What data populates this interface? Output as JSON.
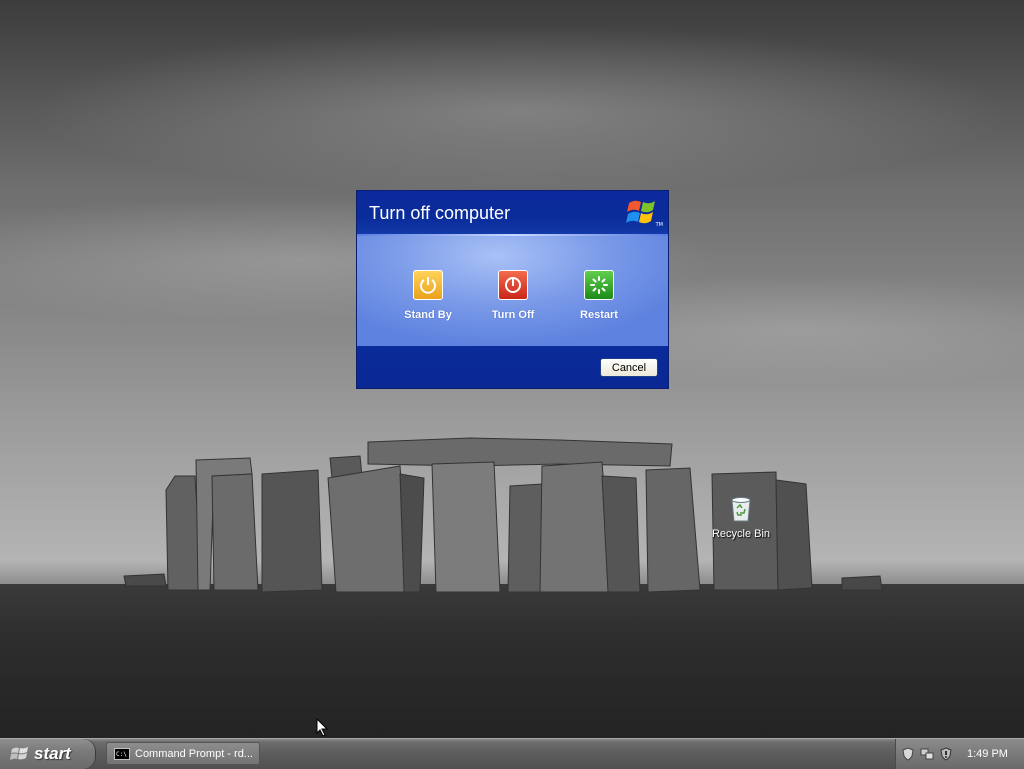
{
  "desktop": {
    "icons": [
      {
        "label": "Recycle Bin",
        "icon": "recycle-bin-icon"
      }
    ]
  },
  "dialog": {
    "title": "Turn off computer",
    "options": [
      {
        "label": "Stand By",
        "icon": "standby-icon",
        "color": "#f0b323"
      },
      {
        "label": "Turn Off",
        "icon": "power-icon",
        "color": "#e0442e"
      },
      {
        "label": "Restart",
        "icon": "restart-icon",
        "color": "#3aae2e"
      }
    ],
    "cancel_label": "Cancel",
    "logo": "windows-logo-icon",
    "logo_mark": "TM"
  },
  "taskbar": {
    "start_label": "start",
    "tasks": [
      {
        "label": "Command Prompt - rd...",
        "icon": "command-prompt-icon",
        "icon_text": "C:\\"
      }
    ],
    "tray_icons": [
      "security-shield-icon",
      "network-icon",
      "security-alert-icon"
    ],
    "clock": "1:49 PM"
  }
}
